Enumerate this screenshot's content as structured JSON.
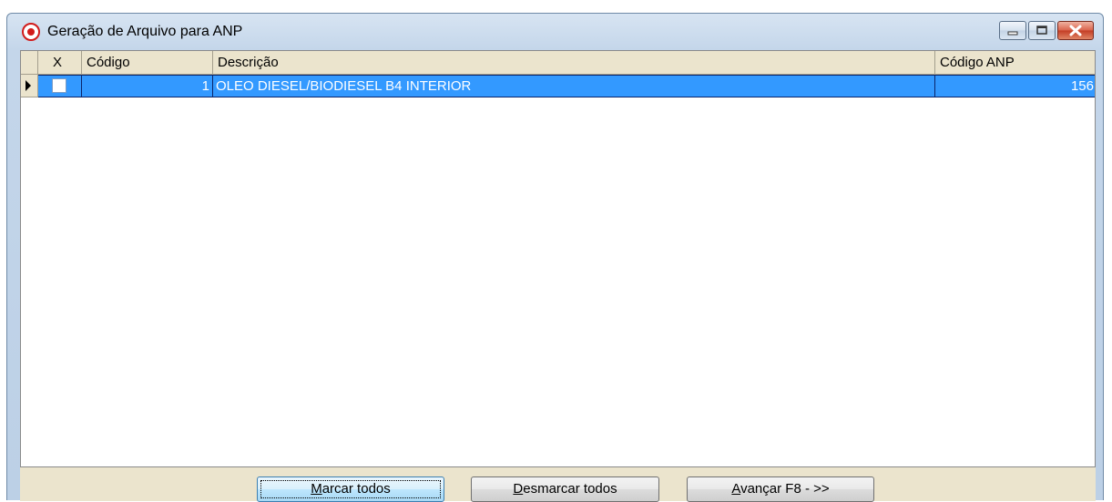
{
  "window": {
    "title": "Geração de Arquivo para ANP"
  },
  "grid": {
    "columns": {
      "check": "X",
      "codigo": "Código",
      "descricao": "Descrição",
      "codigo_anp": "Código ANP"
    },
    "rows": [
      {
        "checked": false,
        "codigo": "1",
        "descricao": "OLEO DIESEL/BIODIESEL B4 INTERIOR",
        "codigo_anp": "156"
      }
    ]
  },
  "buttons": {
    "marcar": {
      "accel": "M",
      "rest": "arcar todos"
    },
    "desmarcar": {
      "accel": "D",
      "rest": "esmarcar todos"
    },
    "avancar": {
      "accel": "A",
      "rest": "vançar F8 - >>"
    }
  },
  "colors": {
    "selection": "#3399ff",
    "header_bg": "#ebe4cd",
    "close_button": "#c33d24"
  },
  "icons": {
    "app": "record-target-icon",
    "minimize": "minimize-icon",
    "maximize": "maximize-icon",
    "close": "close-icon",
    "row_indicator": "row-pointer-icon"
  }
}
